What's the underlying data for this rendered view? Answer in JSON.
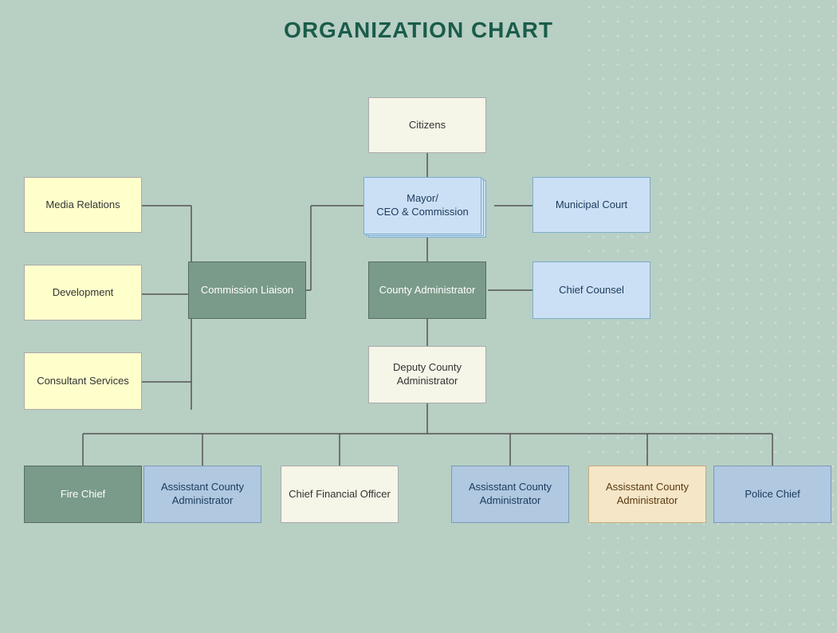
{
  "title": "ORGANIZATION CHART",
  "nodes": {
    "citizens": {
      "label": "Citizens"
    },
    "mayor": {
      "label": "Mayor/\nCEO & Commission"
    },
    "municipal_court": {
      "label": "Municipal Court"
    },
    "county_admin": {
      "label": "County\nAdministrator"
    },
    "commission_liaison": {
      "label": "Commission\nLiaison"
    },
    "chief_counsel": {
      "label": "Chief Counsel"
    },
    "media_relations": {
      "label": "Media Relations"
    },
    "development": {
      "label": "Development"
    },
    "consultant_services": {
      "label": "Consultant\nServices"
    },
    "deputy_county_admin": {
      "label": "Deputy County\nAdministrator"
    },
    "fire_chief": {
      "label": "Fire Chief"
    },
    "asst_admin_1": {
      "label": "Assisstant County\nAdministrator"
    },
    "cfo": {
      "label": "Chief Financial\nOfficer"
    },
    "asst_admin_2": {
      "label": "Assisstant County\nAdministrator"
    },
    "asst_admin_3": {
      "label": "Assisstant County\nAdministrator"
    },
    "police_chief": {
      "label": "Police Chief"
    }
  }
}
